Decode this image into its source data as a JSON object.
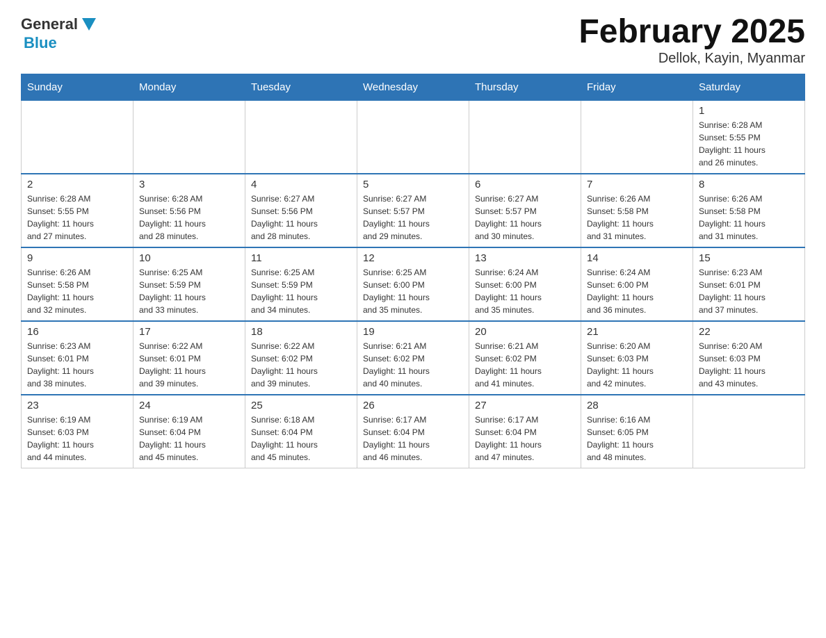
{
  "header": {
    "logo_general": "General",
    "logo_blue": "Blue",
    "title": "February 2025",
    "subtitle": "Dellok, Kayin, Myanmar"
  },
  "days_of_week": [
    "Sunday",
    "Monday",
    "Tuesday",
    "Wednesday",
    "Thursday",
    "Friday",
    "Saturday"
  ],
  "weeks": [
    [
      {
        "day": "",
        "info": ""
      },
      {
        "day": "",
        "info": ""
      },
      {
        "day": "",
        "info": ""
      },
      {
        "day": "",
        "info": ""
      },
      {
        "day": "",
        "info": ""
      },
      {
        "day": "",
        "info": ""
      },
      {
        "day": "1",
        "info": "Sunrise: 6:28 AM\nSunset: 5:55 PM\nDaylight: 11 hours\nand 26 minutes."
      }
    ],
    [
      {
        "day": "2",
        "info": "Sunrise: 6:28 AM\nSunset: 5:55 PM\nDaylight: 11 hours\nand 27 minutes."
      },
      {
        "day": "3",
        "info": "Sunrise: 6:28 AM\nSunset: 5:56 PM\nDaylight: 11 hours\nand 28 minutes."
      },
      {
        "day": "4",
        "info": "Sunrise: 6:27 AM\nSunset: 5:56 PM\nDaylight: 11 hours\nand 28 minutes."
      },
      {
        "day": "5",
        "info": "Sunrise: 6:27 AM\nSunset: 5:57 PM\nDaylight: 11 hours\nand 29 minutes."
      },
      {
        "day": "6",
        "info": "Sunrise: 6:27 AM\nSunset: 5:57 PM\nDaylight: 11 hours\nand 30 minutes."
      },
      {
        "day": "7",
        "info": "Sunrise: 6:26 AM\nSunset: 5:58 PM\nDaylight: 11 hours\nand 31 minutes."
      },
      {
        "day": "8",
        "info": "Sunrise: 6:26 AM\nSunset: 5:58 PM\nDaylight: 11 hours\nand 31 minutes."
      }
    ],
    [
      {
        "day": "9",
        "info": "Sunrise: 6:26 AM\nSunset: 5:58 PM\nDaylight: 11 hours\nand 32 minutes."
      },
      {
        "day": "10",
        "info": "Sunrise: 6:25 AM\nSunset: 5:59 PM\nDaylight: 11 hours\nand 33 minutes."
      },
      {
        "day": "11",
        "info": "Sunrise: 6:25 AM\nSunset: 5:59 PM\nDaylight: 11 hours\nand 34 minutes."
      },
      {
        "day": "12",
        "info": "Sunrise: 6:25 AM\nSunset: 6:00 PM\nDaylight: 11 hours\nand 35 minutes."
      },
      {
        "day": "13",
        "info": "Sunrise: 6:24 AM\nSunset: 6:00 PM\nDaylight: 11 hours\nand 35 minutes."
      },
      {
        "day": "14",
        "info": "Sunrise: 6:24 AM\nSunset: 6:00 PM\nDaylight: 11 hours\nand 36 minutes."
      },
      {
        "day": "15",
        "info": "Sunrise: 6:23 AM\nSunset: 6:01 PM\nDaylight: 11 hours\nand 37 minutes."
      }
    ],
    [
      {
        "day": "16",
        "info": "Sunrise: 6:23 AM\nSunset: 6:01 PM\nDaylight: 11 hours\nand 38 minutes."
      },
      {
        "day": "17",
        "info": "Sunrise: 6:22 AM\nSunset: 6:01 PM\nDaylight: 11 hours\nand 39 minutes."
      },
      {
        "day": "18",
        "info": "Sunrise: 6:22 AM\nSunset: 6:02 PM\nDaylight: 11 hours\nand 39 minutes."
      },
      {
        "day": "19",
        "info": "Sunrise: 6:21 AM\nSunset: 6:02 PM\nDaylight: 11 hours\nand 40 minutes."
      },
      {
        "day": "20",
        "info": "Sunrise: 6:21 AM\nSunset: 6:02 PM\nDaylight: 11 hours\nand 41 minutes."
      },
      {
        "day": "21",
        "info": "Sunrise: 6:20 AM\nSunset: 6:03 PM\nDaylight: 11 hours\nand 42 minutes."
      },
      {
        "day": "22",
        "info": "Sunrise: 6:20 AM\nSunset: 6:03 PM\nDaylight: 11 hours\nand 43 minutes."
      }
    ],
    [
      {
        "day": "23",
        "info": "Sunrise: 6:19 AM\nSunset: 6:03 PM\nDaylight: 11 hours\nand 44 minutes."
      },
      {
        "day": "24",
        "info": "Sunrise: 6:19 AM\nSunset: 6:04 PM\nDaylight: 11 hours\nand 45 minutes."
      },
      {
        "day": "25",
        "info": "Sunrise: 6:18 AM\nSunset: 6:04 PM\nDaylight: 11 hours\nand 45 minutes."
      },
      {
        "day": "26",
        "info": "Sunrise: 6:17 AM\nSunset: 6:04 PM\nDaylight: 11 hours\nand 46 minutes."
      },
      {
        "day": "27",
        "info": "Sunrise: 6:17 AM\nSunset: 6:04 PM\nDaylight: 11 hours\nand 47 minutes."
      },
      {
        "day": "28",
        "info": "Sunrise: 6:16 AM\nSunset: 6:05 PM\nDaylight: 11 hours\nand 48 minutes."
      },
      {
        "day": "",
        "info": ""
      }
    ]
  ],
  "colors": {
    "header_bg": "#2e74b5",
    "header_text": "#ffffff",
    "accent": "#1a8fc1"
  }
}
